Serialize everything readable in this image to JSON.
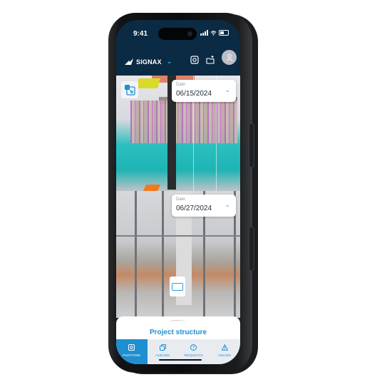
{
  "status_bar": {
    "time": "9:41",
    "signal_icon": "signal-bars-icon",
    "wifi_icon": "wifi-icon",
    "battery_icon": "battery-icon"
  },
  "app_bar": {
    "brand": "SIGNAX",
    "brand_icon": "signax-logo-icon",
    "project_switch_icon": "chevron-down-icon",
    "actions": [
      {
        "name": "photo-360-icon"
      },
      {
        "name": "share-folder-icon"
      },
      {
        "name": "user-avatar-icon"
      }
    ]
  },
  "top_view": {
    "type": "BIM model",
    "date_label": "Date",
    "date_value": "06/15/2024",
    "compare_icon": "split-compare-icon"
  },
  "bottom_view": {
    "type": "360 photo",
    "date_label": "Date",
    "date_value": "06/27/2024",
    "view_mode_icon": "single-view-icon"
  },
  "sheet": {
    "title": "Project structure"
  },
  "tabs": [
    {
      "label": "PHOTO360",
      "icon": "photo-360-icon",
      "active": true
    },
    {
      "label": "ALBUMS",
      "icon": "albums-icon",
      "active": false
    },
    {
      "label": "REQUESTS",
      "icon": "question-icon",
      "active": false
    },
    {
      "label": "ISSUES",
      "icon": "warning-icon",
      "active": false
    }
  ],
  "colors": {
    "accent": "#1e8fd0",
    "header": "#0b2a43",
    "tabbar": "#e8ecf0"
  }
}
